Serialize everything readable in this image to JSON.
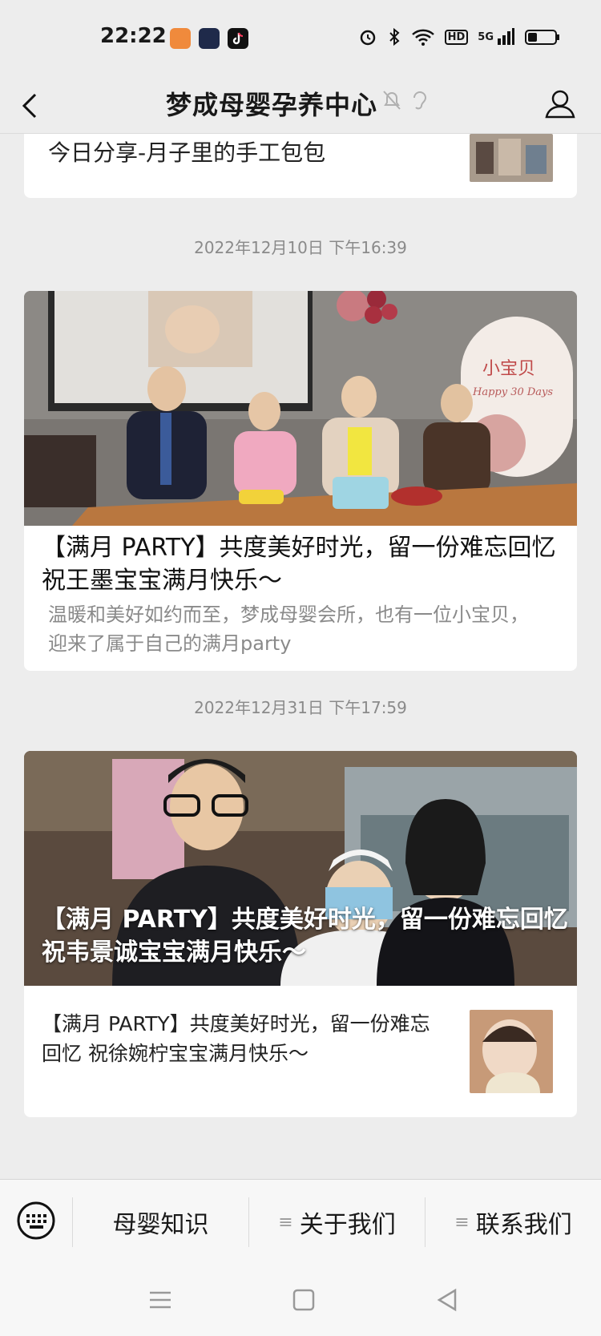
{
  "status": {
    "time": "22:22",
    "network": "5G",
    "hd": "HD"
  },
  "header": {
    "title": "梦成母婴孕养中心"
  },
  "feed": {
    "top_card": {
      "title": "今日分享-月子里的手工包包"
    },
    "post1": {
      "timestamp": "2022年12月10日 下午16:39",
      "headline": "【满月 PARTY】共度美好时光，留一份难忘回忆 祝王墨宝宝满月快乐～",
      "digest": "温暖和美好如约而至，梦成母婴会所，也有一位小宝贝，迎来了属于自己的满月party",
      "banner_text": "小宝贝",
      "banner_sub": "Happy 30 Days"
    },
    "post2": {
      "timestamp": "2022年12月31日 下午17:59",
      "headline": "【满月 PARTY】共度美好时光，留一份难忘回忆 祝韦景诚宝宝满月快乐～",
      "sub_title": "【满月 PARTY】共度美好时光，留一份难忘回忆 祝徐婉柠宝宝满月快乐～"
    }
  },
  "menu": {
    "items": [
      {
        "label": "母婴知识"
      },
      {
        "label": "关于我们"
      },
      {
        "label": "联系我们"
      }
    ]
  },
  "colors": {
    "background": "#ededed",
    "card": "#ffffff",
    "timestamp": "#8a8a8a"
  }
}
